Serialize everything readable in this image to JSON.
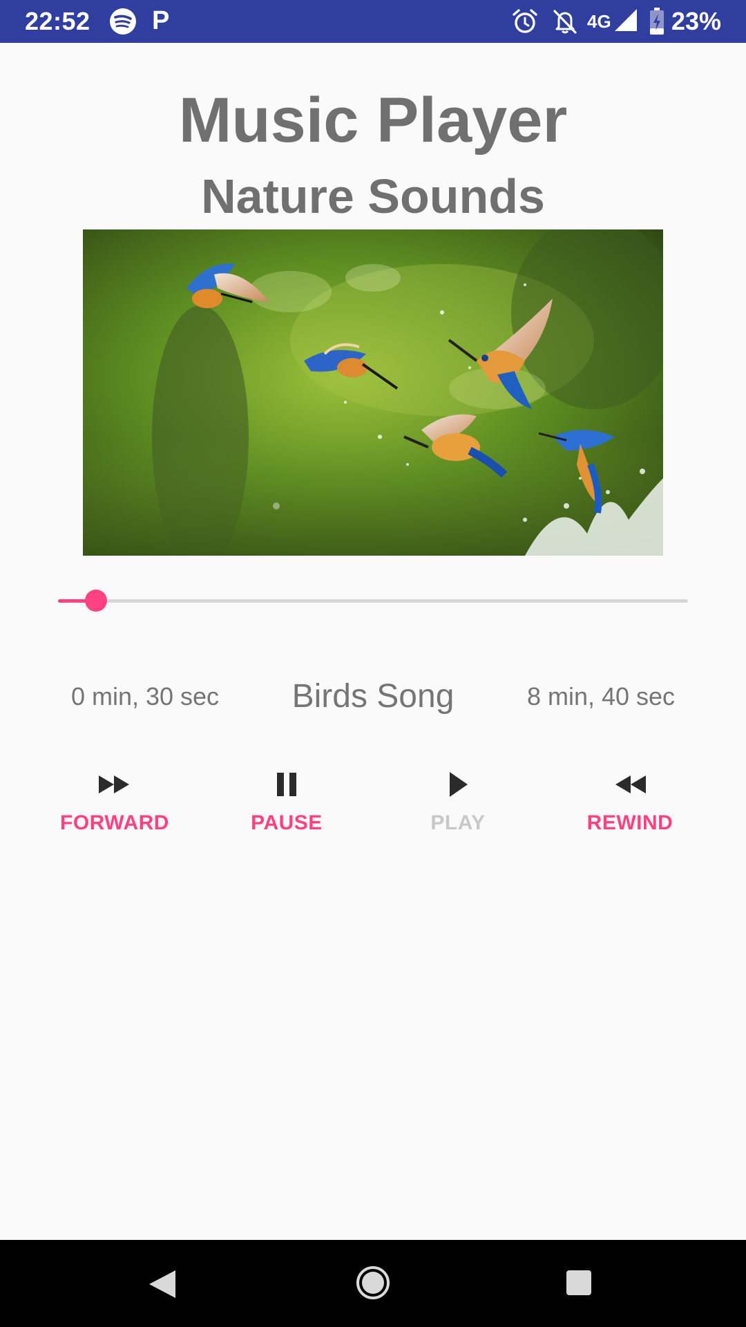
{
  "status_bar": {
    "time": "22:52",
    "p_label": "P",
    "network": "4G",
    "battery": "23%",
    "icons": [
      "spotify-icon",
      "p-icon",
      "alarm-icon",
      "bell-off-icon",
      "signal-icon",
      "battery-charging-icon"
    ],
    "background": "#303f9f"
  },
  "app": {
    "title": "Music Player",
    "subtitle": "Nature Sounds"
  },
  "album_art": {
    "icon": "kingfishers-photo"
  },
  "player": {
    "progress": 0.06,
    "current_time": "0 min, 30 sec",
    "song": "Birds Song",
    "total_time": "8 min, 40 sec",
    "accent": "#ff4081"
  },
  "controls": {
    "forward": {
      "label": "FORWARD",
      "icon": "fast-forward-icon",
      "enabled": true
    },
    "pause": {
      "label": "PAUSE",
      "icon": "pause-icon",
      "enabled": true
    },
    "play": {
      "label": "PLAY",
      "icon": "play-icon",
      "enabled": false
    },
    "rewind": {
      "label": "REWIND",
      "icon": "rewind-icon",
      "enabled": true
    },
    "enabled_color": "#ff4081",
    "disabled_color": "#c8c8c8",
    "icon_color": "#2b2b2b"
  },
  "nav_bar": {
    "icons": [
      "back-icon",
      "home-icon",
      "recents-icon"
    ]
  }
}
